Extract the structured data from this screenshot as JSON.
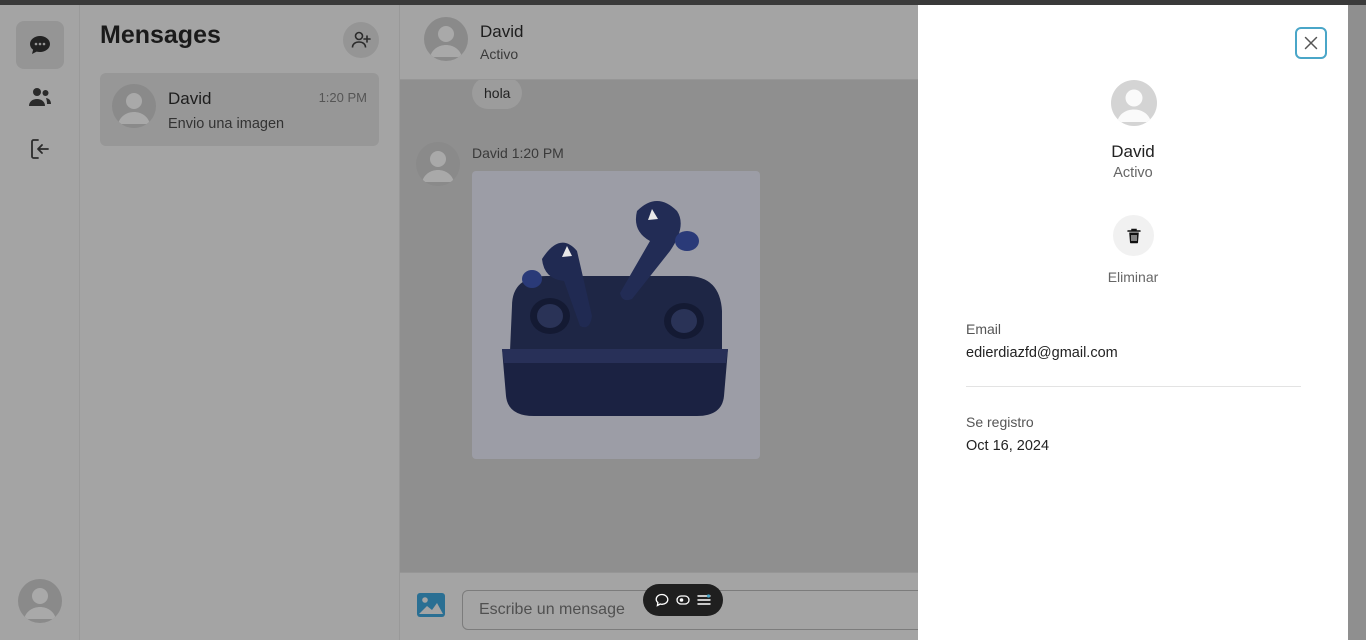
{
  "sidebar": {
    "items": [
      {
        "name": "chats",
        "icon": "chat-bubble-icon"
      },
      {
        "name": "contacts",
        "icon": "users-icon"
      },
      {
        "name": "logout",
        "icon": "logout-icon"
      }
    ],
    "user_icon": "user-avatar-icon"
  },
  "conversations": {
    "title": "Mensages",
    "add_icon": "add-user-icon",
    "items": [
      {
        "name": "David",
        "time": "1:20 PM",
        "last_message": "Envio una imagen"
      }
    ]
  },
  "chat": {
    "contact_name": "David",
    "contact_status": "Activo",
    "messages": [
      {
        "text": "hola"
      },
      {
        "author": "David",
        "time": "1:20 PM",
        "type": "image",
        "image_subject": "wireless earbuds in charging case"
      }
    ],
    "input_placeholder": "Escribe un mensage",
    "image_icon": "image-icon"
  },
  "floating_toolbar": {
    "icons": [
      "comment-icon",
      "eye-icon",
      "menu-icon"
    ]
  },
  "profile_panel": {
    "name": "David",
    "status": "Activo",
    "delete_label": "Eliminar",
    "email_label": "Email",
    "email_value": "edierdiazfd@gmail.com",
    "registered_label": "Se registro",
    "registered_value": "Oct 16, 2024",
    "accent_color": "#4aa6c8"
  }
}
